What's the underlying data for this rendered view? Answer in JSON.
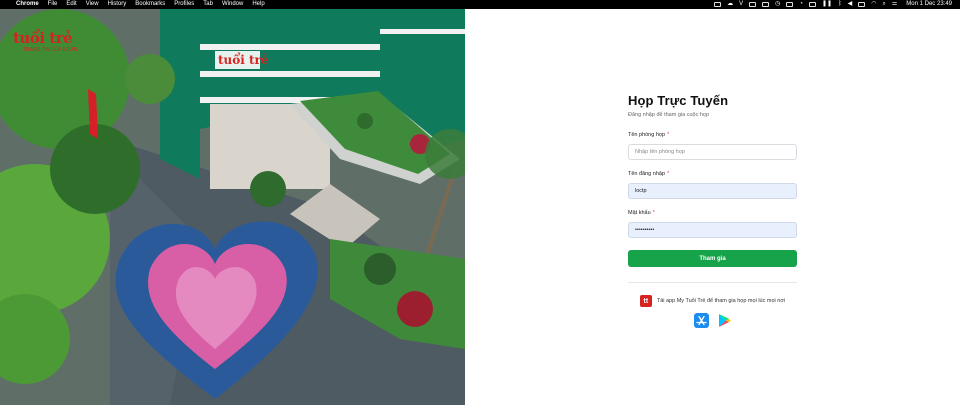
{
  "menubar": {
    "apple_glyph": "",
    "app_name": "Chrome",
    "items": [
      "File",
      "Edit",
      "View",
      "History",
      "Bookmarks",
      "Profiles",
      "Tab",
      "Window",
      "Help"
    ],
    "tray_letter": "V",
    "datetime": "Mon 1 Dec  23:49"
  },
  "photo": {
    "logo_text": "tuổi trẻ",
    "logo_tagline": "TRANG TIN CỦA ĐOÀN",
    "building_sign": "tuổi trẻ"
  },
  "login": {
    "title": "Họp Trực Tuyến",
    "subtitle": "Đăng nhập để tham gia cuộc họp",
    "room": {
      "label": "Tên phòng họp",
      "required": "*",
      "placeholder": "Nhập tên phòng họp",
      "value": ""
    },
    "username": {
      "label": "Tên đăng nhập",
      "required": "*",
      "value": "loctp"
    },
    "password": {
      "label": "Mật khẩu",
      "required": "*",
      "value": "••••••••••"
    },
    "submit_label": "Tham gia"
  },
  "promo": {
    "app_icon_letter": "tt",
    "text": "Tải app My Tuổi Trẻ để tham gia họp mọi lúc mọi nơi",
    "stores": [
      "app-store-icon",
      "google-play-icon"
    ]
  },
  "colors": {
    "primary": "#16a34a",
    "brand_red": "#d6231f",
    "input_filled_bg": "#e8f0fe"
  }
}
